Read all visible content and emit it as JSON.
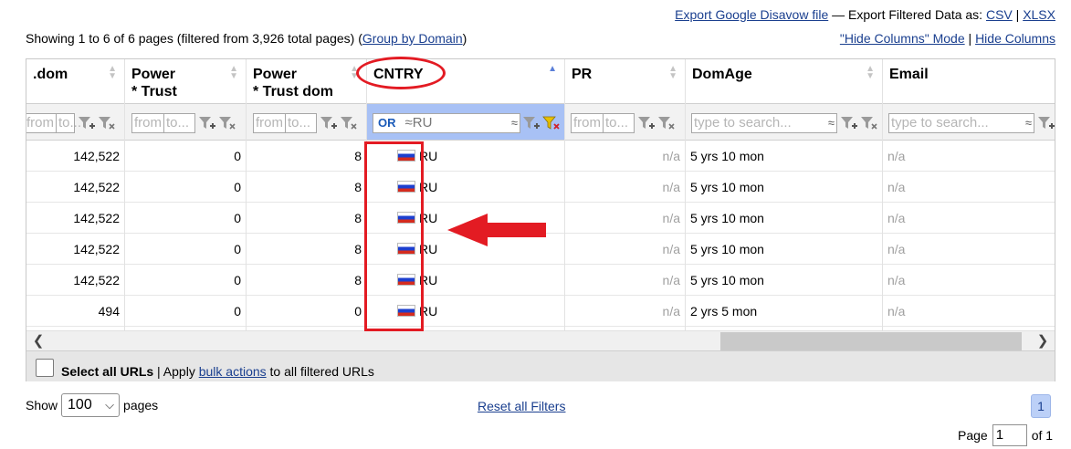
{
  "export": {
    "disavow_link": "Export Google Disavow file",
    "separator": " — Export Filtered Data as: ",
    "csv": "CSV",
    "pipe": " | ",
    "xlsx": "XLSX"
  },
  "summary": {
    "showing": "Showing 1 to 6 of 6 pages (filtered from 3,926 total pages) (",
    "group_link": "Group by Domain",
    "close": ")"
  },
  "columns_links": {
    "hide_mode": "\"Hide Columns\" Mode",
    "pipe": " | ",
    "hide": "Hide Columns"
  },
  "columns": [
    {
      "key": "dom",
      "line1": ".dom",
      "line2": ""
    },
    {
      "key": "power_trust",
      "line1": "Power",
      "line2": "* Trust"
    },
    {
      "key": "power_trust_dom",
      "line1": "Power",
      "line2": "* Trust dom"
    },
    {
      "key": "cntry",
      "line1": "CNTRY",
      "line2": ""
    },
    {
      "key": "pr",
      "line1": "PR",
      "line2": ""
    },
    {
      "key": "domage",
      "line1": "DomAge",
      "line2": ""
    },
    {
      "key": "email",
      "line1": "Email",
      "line2": ""
    }
  ],
  "filters": {
    "range_from": "from",
    "range_to": "to...",
    "range_to_short": "to",
    "cntry_operator": "OR",
    "cntry_value": "≈RU",
    "approx": "≈",
    "search_placeholder": "type to search..."
  },
  "rows": [
    {
      "dom": "142,522",
      "power_trust": "0",
      "power_trust_dom": "8",
      "cntry": "RU",
      "pr": "n/a",
      "domage": "5 yrs 10 mon",
      "email": "n/a"
    },
    {
      "dom": "142,522",
      "power_trust": "0",
      "power_trust_dom": "8",
      "cntry": "RU",
      "pr": "n/a",
      "domage": "5 yrs 10 mon",
      "email": "n/a"
    },
    {
      "dom": "142,522",
      "power_trust": "0",
      "power_trust_dom": "8",
      "cntry": "RU",
      "pr": "n/a",
      "domage": "5 yrs 10 mon",
      "email": "n/a"
    },
    {
      "dom": "142,522",
      "power_trust": "0",
      "power_trust_dom": "8",
      "cntry": "RU",
      "pr": "n/a",
      "domage": "5 yrs 10 mon",
      "email": "n/a"
    },
    {
      "dom": "142,522",
      "power_trust": "0",
      "power_trust_dom": "8",
      "cntry": "RU",
      "pr": "n/a",
      "domage": "5 yrs 10 mon",
      "email": "n/a"
    },
    {
      "dom": "494",
      "power_trust": "0",
      "power_trust_dom": "0",
      "cntry": "RU",
      "pr": "n/a",
      "domage": "2 yrs 5 mon",
      "email": "n/a"
    }
  ],
  "bulk": {
    "select_all": "Select all URLs",
    "apply": " | Apply ",
    "bulk_link": "bulk actions",
    "rest": " to all filtered URLs"
  },
  "paging": {
    "show_label": "Show",
    "page_size": "100",
    "pages_label": "pages",
    "reset_filters": "Reset all Filters",
    "current_page_button": "1",
    "page_label": "Page",
    "page_input": "1",
    "of_label": "of 1"
  },
  "colors": {
    "link": "#1a3f8f",
    "active_filter": "#a8c1f5",
    "annotation": "#e31b23"
  }
}
